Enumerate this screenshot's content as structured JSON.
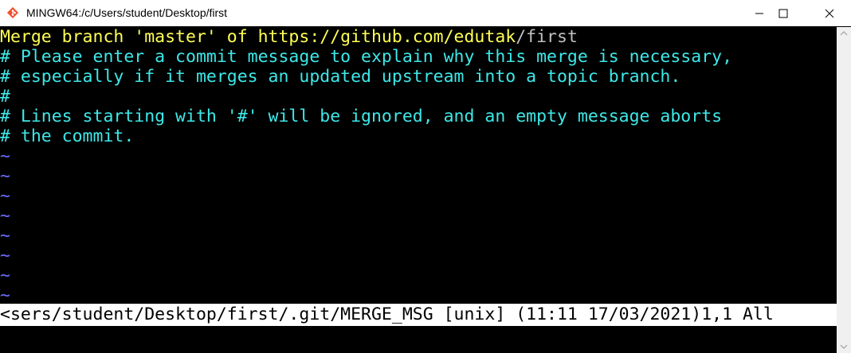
{
  "window": {
    "title": "MINGW64:/c/Users/student/Desktop/first",
    "icon": "git-icon"
  },
  "colors": {
    "background": "#000000",
    "yellow": "#ffff55",
    "cyan": "#3ee8e8",
    "tilde": "#6b6bff"
  },
  "editor": {
    "first_line_yellow": "Merge branch 'master' of https://github.com/edutak",
    "first_line_rest": "/first",
    "comments": [
      "# Please enter a commit message to explain why this merge is necessary,",
      "# especially if it merges an updated upstream into a topic branch.",
      "#",
      "# Lines starting with '#' will be ignored, and an empty message aborts",
      "# the commit."
    ],
    "tilde": "~",
    "status_line": "<sers/student/Desktop/first/.git/MERGE_MSG [unix] (11:11 17/03/2021)1,1 All"
  }
}
